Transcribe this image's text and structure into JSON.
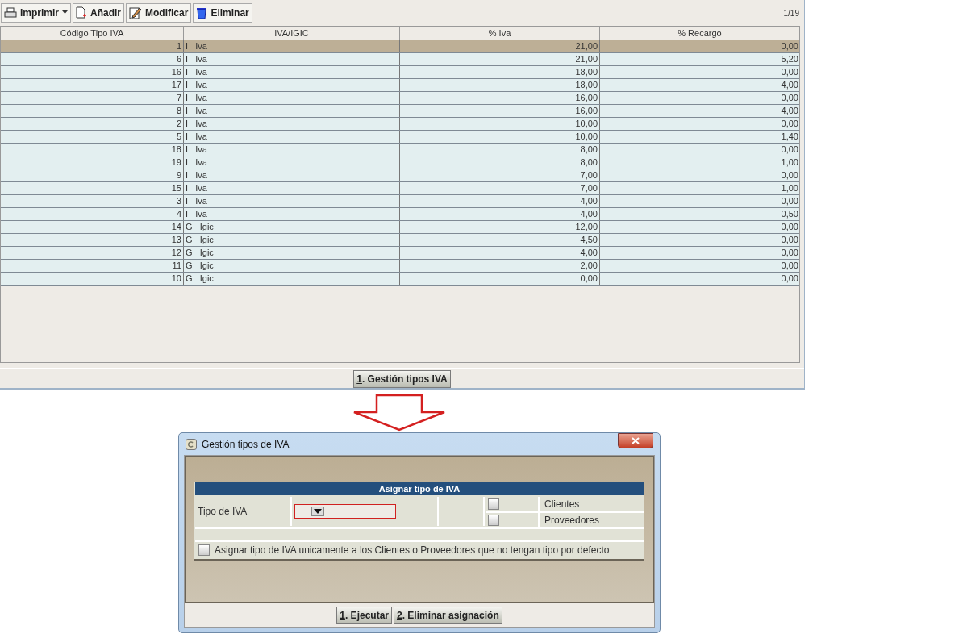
{
  "toolbar": {
    "buttons": [
      {
        "label": "Imprimir",
        "kind": "print"
      },
      {
        "label": "Añadir",
        "kind": "add"
      },
      {
        "label": "Modificar",
        "kind": "edit"
      },
      {
        "label": "Eliminar",
        "kind": "delete"
      }
    ],
    "counter": "1/19"
  },
  "table": {
    "columns": [
      "Código Tipo IVA",
      "IVA/IGIC",
      "% Iva",
      "% Recargo"
    ],
    "rows": [
      {
        "code": "1",
        "type": "I",
        "type_name": "Iva",
        "iva": "21,00",
        "recargo": "0,00",
        "selected": true
      },
      {
        "code": "6",
        "type": "I",
        "type_name": "Iva",
        "iva": "21,00",
        "recargo": "5,20",
        "selected": false
      },
      {
        "code": "16",
        "type": "I",
        "type_name": "Iva",
        "iva": "18,00",
        "recargo": "0,00",
        "selected": false
      },
      {
        "code": "17",
        "type": "I",
        "type_name": "Iva",
        "iva": "18,00",
        "recargo": "4,00",
        "selected": false
      },
      {
        "code": "7",
        "type": "I",
        "type_name": "Iva",
        "iva": "16,00",
        "recargo": "0,00",
        "selected": false
      },
      {
        "code": "8",
        "type": "I",
        "type_name": "Iva",
        "iva": "16,00",
        "recargo": "4,00",
        "selected": false
      },
      {
        "code": "2",
        "type": "I",
        "type_name": "Iva",
        "iva": "10,00",
        "recargo": "0,00",
        "selected": false
      },
      {
        "code": "5",
        "type": "I",
        "type_name": "Iva",
        "iva": "10,00",
        "recargo": "1,40",
        "selected": false
      },
      {
        "code": "18",
        "type": "I",
        "type_name": "Iva",
        "iva": "8,00",
        "recargo": "0,00",
        "selected": false
      },
      {
        "code": "19",
        "type": "I",
        "type_name": "Iva",
        "iva": "8,00",
        "recargo": "1,00",
        "selected": false
      },
      {
        "code": "9",
        "type": "I",
        "type_name": "Iva",
        "iva": "7,00",
        "recargo": "0,00",
        "selected": false
      },
      {
        "code": "15",
        "type": "I",
        "type_name": "Iva",
        "iva": "7,00",
        "recargo": "1,00",
        "selected": false
      },
      {
        "code": "3",
        "type": "I",
        "type_name": "Iva",
        "iva": "4,00",
        "recargo": "0,00",
        "selected": false
      },
      {
        "code": "4",
        "type": "I",
        "type_name": "Iva",
        "iva": "4,00",
        "recargo": "0,50",
        "selected": false
      },
      {
        "code": "14",
        "type": "G",
        "type_name": "Igic",
        "iva": "12,00",
        "recargo": "0,00",
        "selected": false
      },
      {
        "code": "13",
        "type": "G",
        "type_name": "Igic",
        "iva": "4,50",
        "recargo": "0,00",
        "selected": false
      },
      {
        "code": "12",
        "type": "G",
        "type_name": "Igic",
        "iva": "4,00",
        "recargo": "0,00",
        "selected": false
      },
      {
        "code": "11",
        "type": "G",
        "type_name": "Igic",
        "iva": "2,00",
        "recargo": "0,00",
        "selected": false
      },
      {
        "code": "10",
        "type": "G",
        "type_name": "Igic",
        "iva": "0,00",
        "recargo": "0,00",
        "selected": false
      }
    ]
  },
  "footer_button": {
    "mnemonic": "1",
    "label": ". Gestión tipos IVA"
  },
  "dialog": {
    "title": "Gestión tipos de IVA",
    "section_title": "Asignar tipo de IVA",
    "field_label": "Tipo de IVA",
    "options": [
      {
        "label": "Clientes",
        "checked": false
      },
      {
        "label": "Proveedores",
        "checked": false
      }
    ],
    "only_default": {
      "label": "Asignar tipo de IVA unicamente a los Clientes o Proveedores que no tengan tipo por defecto",
      "checked": false
    },
    "buttons": [
      {
        "mnemonic": "1",
        "label": ". Ejecutar"
      },
      {
        "mnemonic": "2",
        "label": ". Eliminar asignación"
      }
    ]
  }
}
